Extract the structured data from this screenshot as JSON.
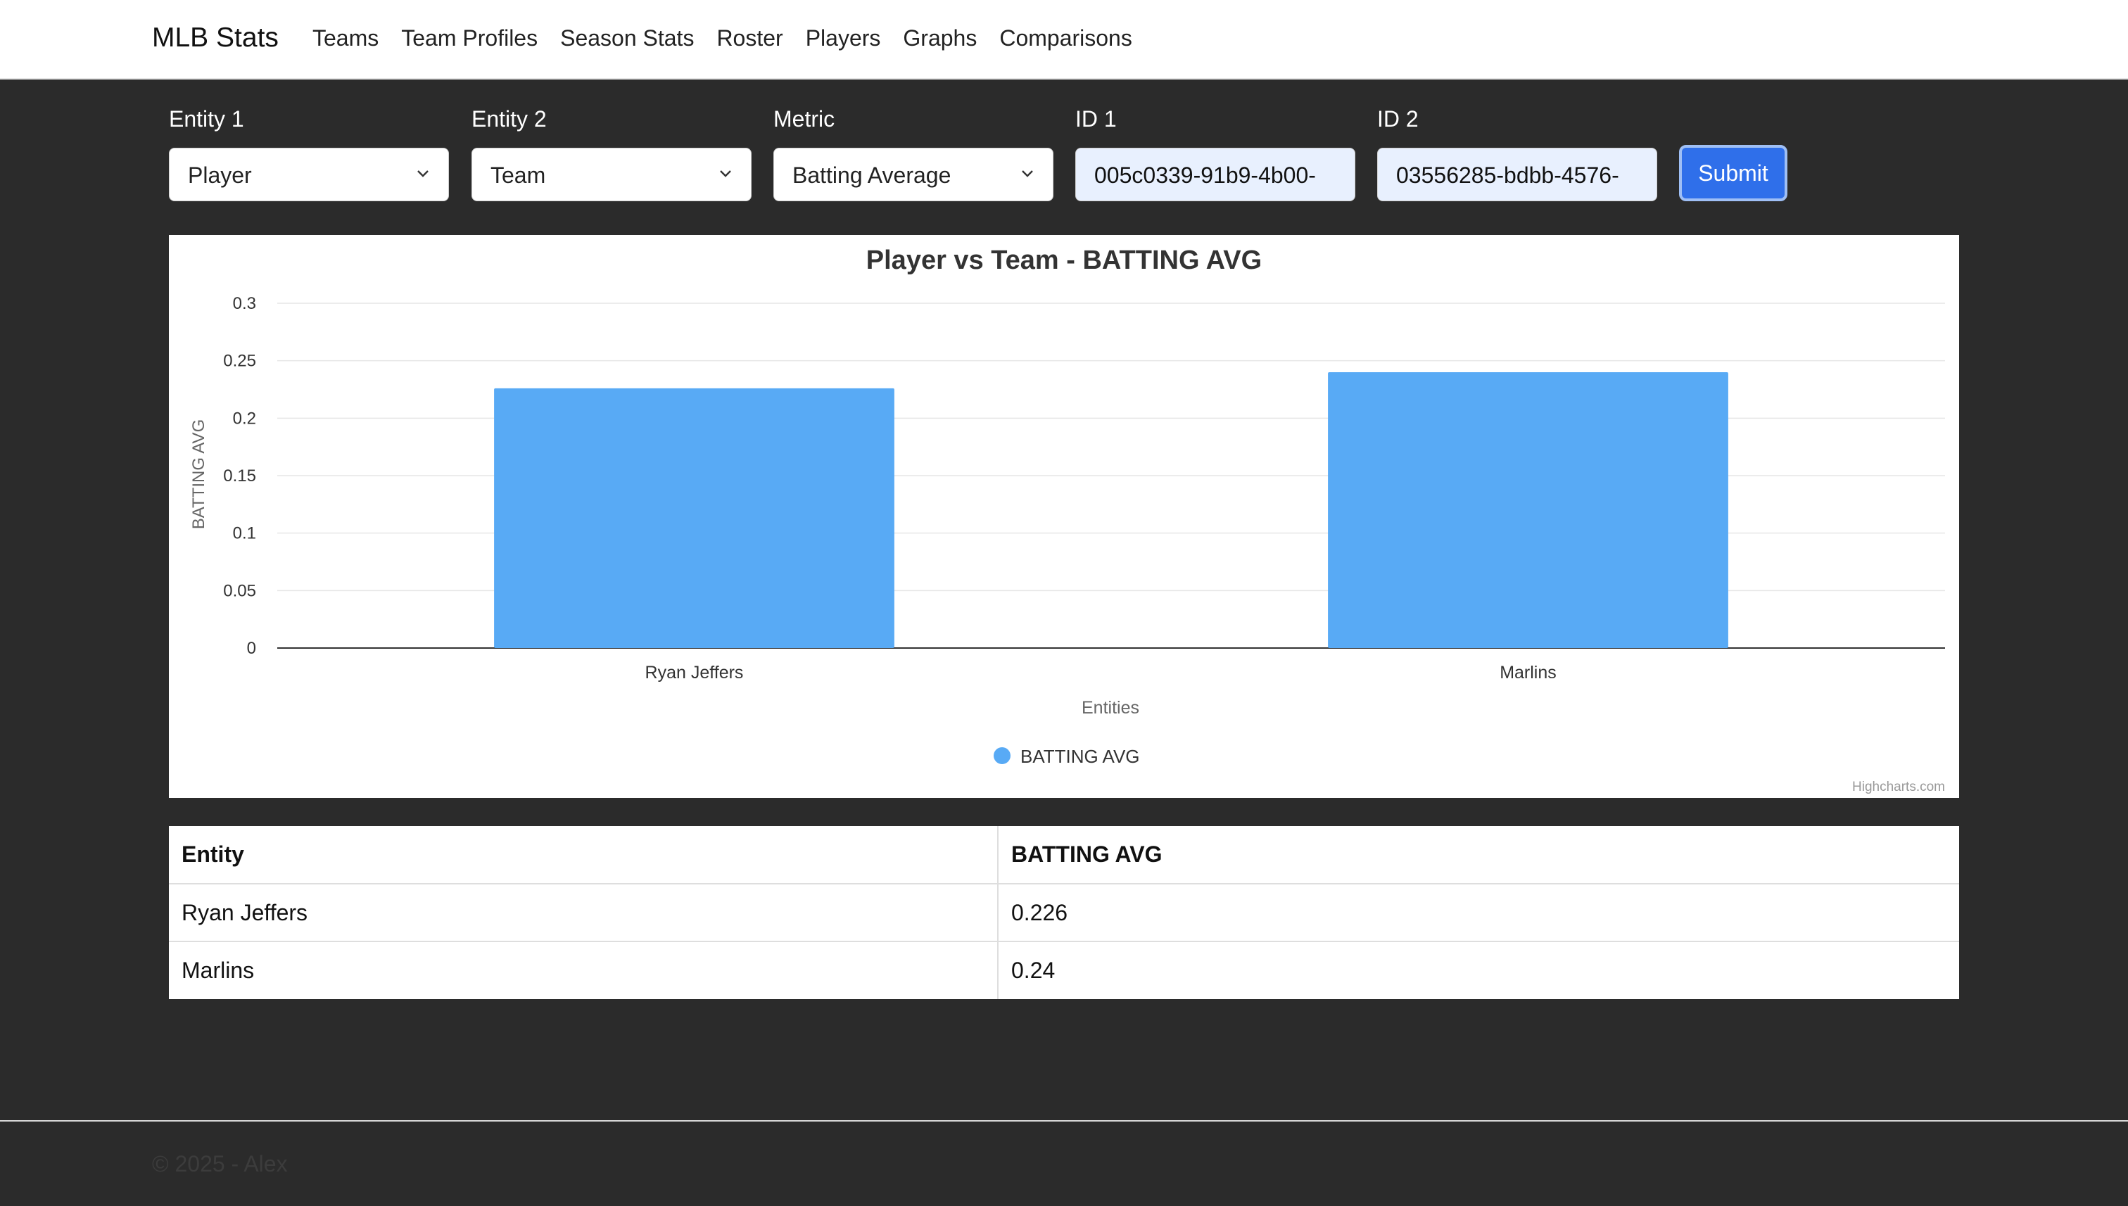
{
  "nav": {
    "brand": "MLB Stats",
    "links": [
      "Teams",
      "Team Profiles",
      "Season Stats",
      "Roster",
      "Players",
      "Graphs",
      "Comparisons"
    ]
  },
  "form": {
    "entity1": {
      "label": "Entity 1",
      "value": "Player"
    },
    "entity2": {
      "label": "Entity 2",
      "value": "Team"
    },
    "metric": {
      "label": "Metric",
      "value": "Batting Average"
    },
    "id1": {
      "label": "ID 1",
      "value": "005c0339-91b9-4b00-"
    },
    "id2": {
      "label": "ID 2",
      "value": "03556285-bdbb-4576-"
    },
    "submit_label": "Submit"
  },
  "chart_data": {
    "type": "bar",
    "title": "Player vs Team - BATTING AVG",
    "categories": [
      "Ryan Jeffers",
      "Marlins"
    ],
    "series": [
      {
        "name": "BATTING AVG",
        "values": [
          0.226,
          0.24
        ]
      }
    ],
    "xlabel": "Entities",
    "ylabel": "BATTING AVG",
    "ylim": [
      0,
      0.3
    ],
    "yticks": [
      "0",
      "0.05",
      "0.1",
      "0.15",
      "0.2",
      "0.25",
      "0.3"
    ],
    "grid": true,
    "legend": "bottom-center",
    "bar_color": "#58aaf5",
    "credit": "Highcharts.com"
  },
  "table": {
    "headers": [
      "Entity",
      "BATTING AVG"
    ],
    "rows": [
      [
        "Ryan Jeffers",
        "0.226"
      ],
      [
        "Marlins",
        "0.24"
      ]
    ]
  },
  "footer": {
    "text": "© 2025 - Alex"
  }
}
